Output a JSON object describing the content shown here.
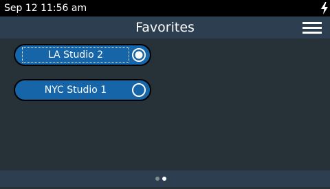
{
  "status_bar": {
    "datetime": "Sep 12 11:56 am",
    "charging_icon": "lightning-bolt"
  },
  "header": {
    "title": "Favorites",
    "menu_icon": "hamburger-menu"
  },
  "favorites": [
    {
      "label": "LA Studio 2",
      "selected": true
    },
    {
      "label": "NYC Studio 1",
      "selected": false
    }
  ],
  "pager": {
    "page_count": 2,
    "current_page": 2
  },
  "colors": {
    "background": "#263238",
    "header": "#2c3e50",
    "status_bar": "#000000",
    "item_fill": "#1565a8",
    "item_border": "#000000",
    "text": "#ffffff"
  }
}
